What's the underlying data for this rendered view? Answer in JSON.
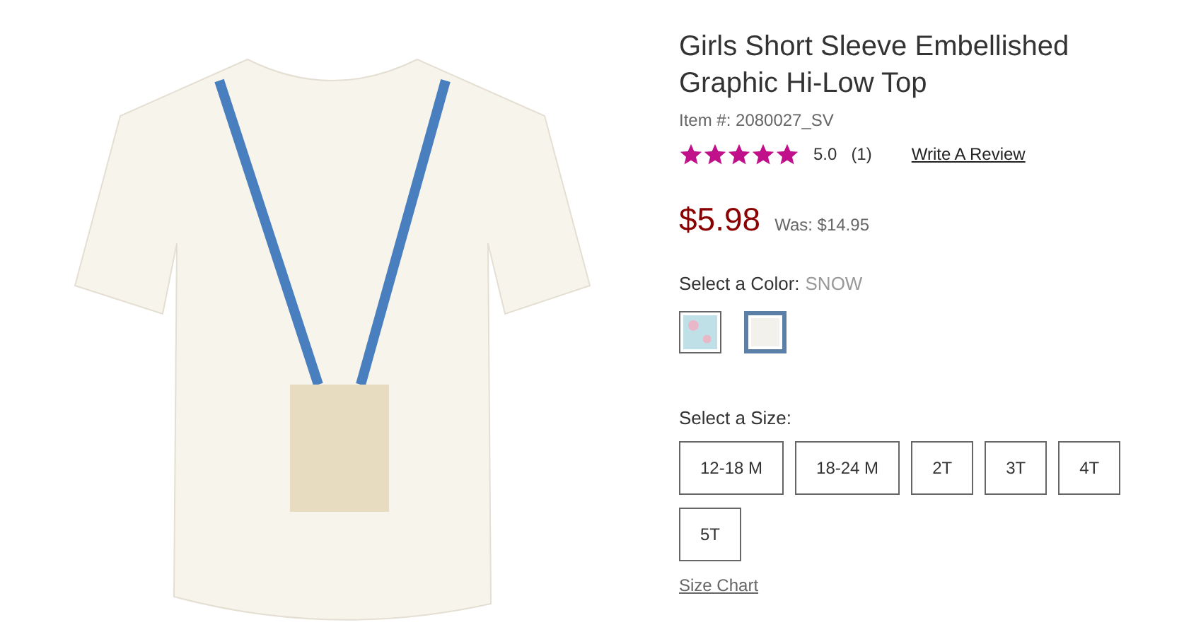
{
  "product": {
    "title": "Girls Short Sleeve Embellished Graphic Hi-Low Top",
    "item_number": "Item #: 2080027_SV",
    "stars": 5,
    "rating": "5.0",
    "review_count": "(1)",
    "write_review": "Write A Review",
    "price": "$5.98",
    "was_price": "Was: $14.95"
  },
  "color": {
    "label": "Select a Color:",
    "value": "SNOW",
    "swatches": [
      {
        "kind": "floral",
        "selected": false
      },
      {
        "kind": "solid",
        "selected": true
      }
    ]
  },
  "size": {
    "label": "Select a Size:",
    "options": [
      {
        "label": "12-18 M",
        "selected": false
      },
      {
        "label": "18-24 M",
        "selected": false
      },
      {
        "label": "2T",
        "selected": false
      },
      {
        "label": "3T",
        "selected": false
      },
      {
        "label": "4T",
        "selected": false
      },
      {
        "label": "5T",
        "selected": false
      }
    ],
    "size_chart": "Size Chart"
  }
}
